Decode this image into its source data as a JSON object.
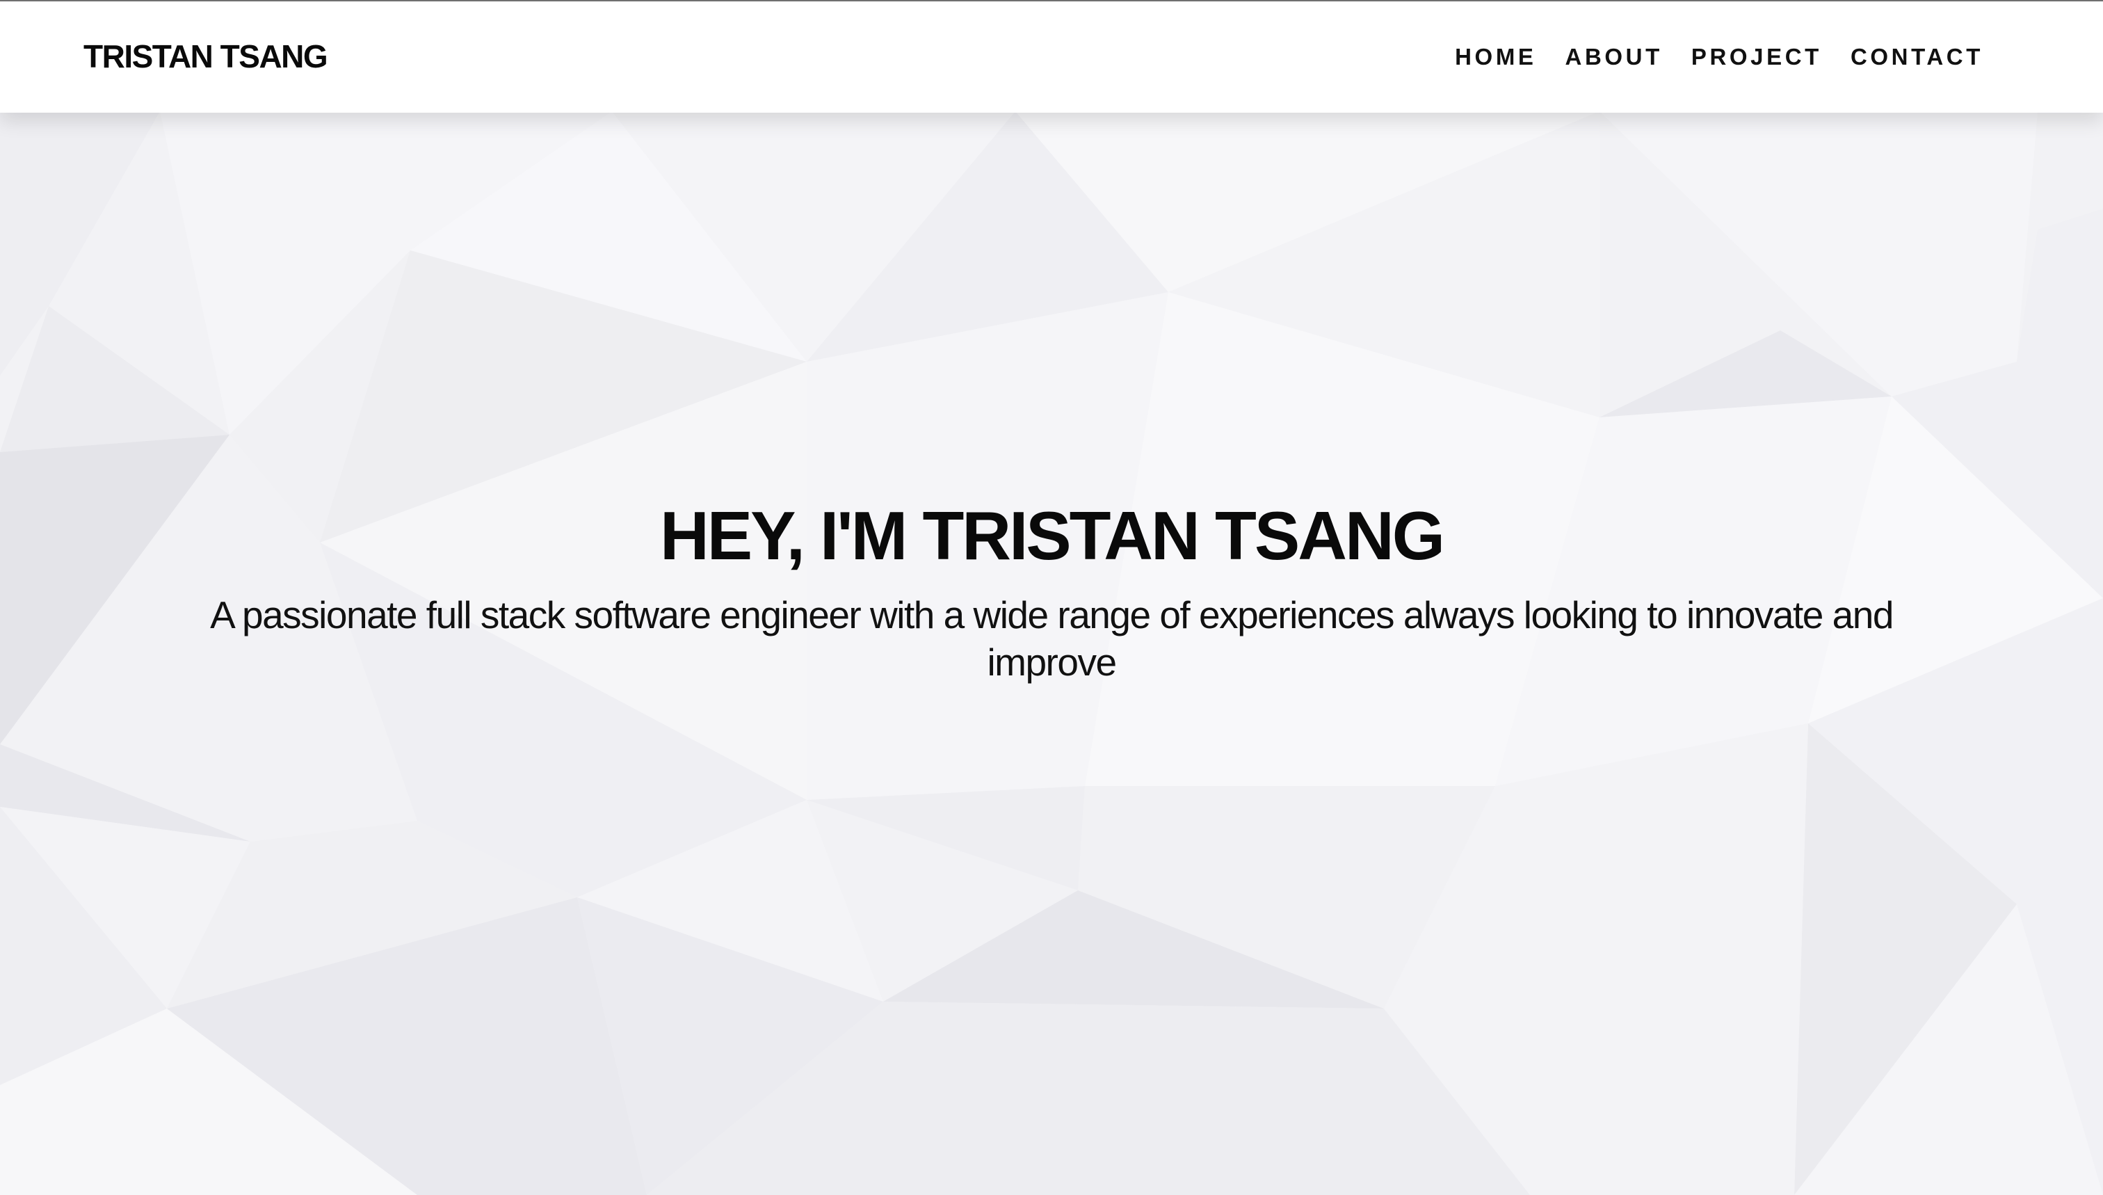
{
  "header": {
    "brand": "TRISTAN TSANG",
    "nav": [
      {
        "label": "HOME"
      },
      {
        "label": "ABOUT"
      },
      {
        "label": "PROJECT"
      },
      {
        "label": "CONTACT"
      }
    ]
  },
  "hero": {
    "title": "HEY, I'M TRISTAN TSANG",
    "subtitle": "A passionate full stack software engineer with a wide range of experiences always looking to innovate and improve"
  },
  "colors": {
    "background": "#f2f2f5",
    "navbar": "#ffffff",
    "text": "#0a0a0a"
  }
}
